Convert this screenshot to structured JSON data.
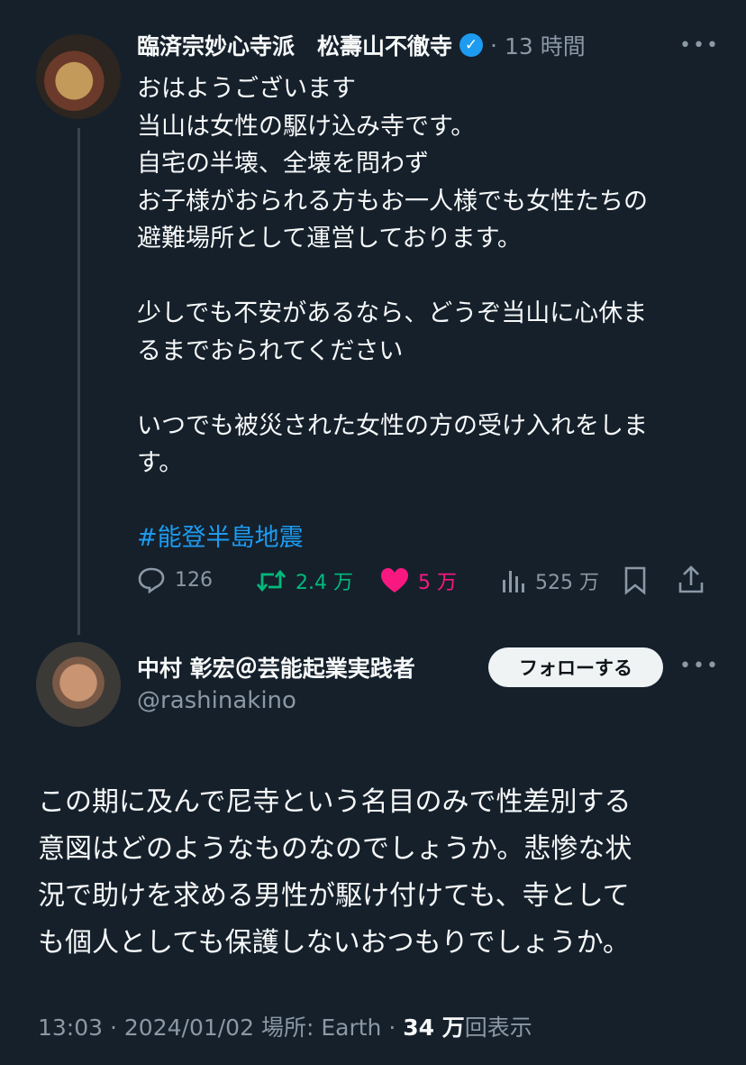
{
  "tweet": {
    "author_name": "臨済宗妙心寺派　松壽山不徹寺",
    "time_ago": "13 時間",
    "lines": [
      "おはようございます",
      "当山は女性の駆け込み寺です。",
      "自宅の半壊、全壊を問わず",
      "お子様がおられる方もお一人様でも女性たちの",
      "避難場所として運営しております。",
      "",
      "少しでも不安があるなら、どうぞ当山に心休ま",
      "るまでおられてください",
      "",
      "いつでも被災された女性の方の受け入れをしま",
      "す。",
      ""
    ],
    "hashtag": "#能登半島地震",
    "stats": {
      "replies": "126",
      "retweets": "2.4 万",
      "likes": "5 万",
      "views": "525 万"
    }
  },
  "reply": {
    "author_name": "中村 彰宏＠芸能起業実践者",
    "handle": "@rashinakino",
    "follow_label": "フォローする",
    "lines": [
      "この期に及んで尼寺という名目のみで性差別する",
      "意図はどのようなものなのでしょうか。悲惨な状",
      "況で助けを求める男性が駆け付けても、寺として",
      "も個人としても保護しないおつもりでしょうか。"
    ],
    "meta": {
      "time": "13:03",
      "date": "2024/01/02",
      "location_label": "場所: Earth",
      "view_count": "34 万",
      "view_suffix": "回表示"
    }
  },
  "colors": {
    "background": "#15202b",
    "text": "#f7f9f9",
    "muted": "#8b98a5",
    "link": "#1d9bf0",
    "retweet": "#00ba7c",
    "like": "#f91880"
  },
  "icons": [
    "verified-badge-icon",
    "more-icon",
    "reply-icon",
    "retweet-icon",
    "like-icon",
    "views-icon",
    "bookmark-icon",
    "share-icon"
  ]
}
